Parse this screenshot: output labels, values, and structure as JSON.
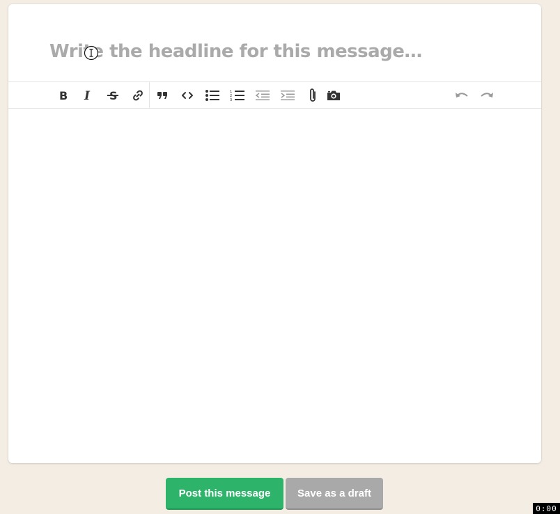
{
  "composer": {
    "headline_placeholder": "Write the headline for this message…",
    "body_text": ""
  },
  "toolbar": {
    "buttons": [
      {
        "name": "bold",
        "icon": "bold-icon"
      },
      {
        "name": "italic",
        "icon": "italic-icon"
      },
      {
        "name": "strikethrough",
        "icon": "strikethrough-icon"
      },
      {
        "name": "link",
        "icon": "link-icon"
      },
      {
        "name": "quote",
        "icon": "quote-icon"
      },
      {
        "name": "code",
        "icon": "code-icon"
      },
      {
        "name": "bullet-list",
        "icon": "bullet-list-icon"
      },
      {
        "name": "numbered-list",
        "icon": "numbered-list-icon"
      },
      {
        "name": "outdent",
        "icon": "outdent-icon"
      },
      {
        "name": "indent",
        "icon": "indent-icon"
      },
      {
        "name": "attach",
        "icon": "paperclip-icon"
      },
      {
        "name": "image",
        "icon": "camera-icon"
      },
      {
        "name": "undo",
        "icon": "undo-icon"
      },
      {
        "name": "redo",
        "icon": "redo-icon"
      }
    ]
  },
  "actions": {
    "post_label": "Post this message",
    "draft_label": "Save as a draft"
  },
  "colors": {
    "background": "#f4ede3",
    "post_button": "#2eb36b",
    "draft_button": "#a9a9a9",
    "placeholder": "#aaaaaa"
  },
  "timer": "0:00"
}
